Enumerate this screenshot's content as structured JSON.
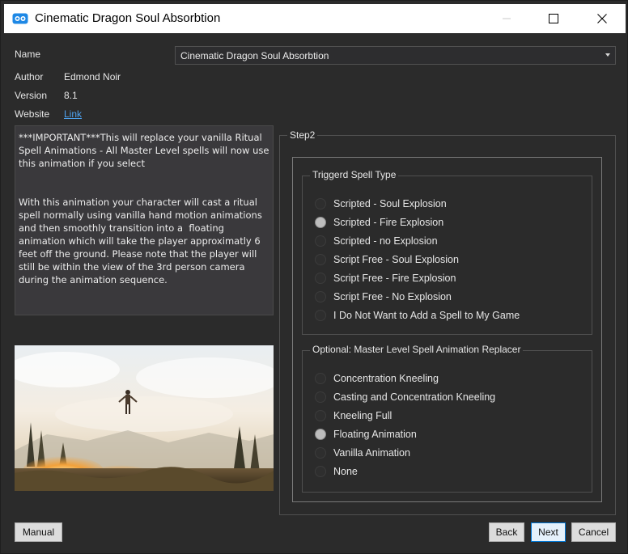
{
  "window": {
    "title": "Cinematic Dragon Soul Absorbtion"
  },
  "info": {
    "name_label": "Name",
    "name_value": "Cinematic Dragon Soul Absorbtion",
    "author_label": "Author",
    "author_value": "Edmond Noir",
    "version_label": "Version",
    "version_value": "8.1",
    "website_label": "Website",
    "website_value": "Link"
  },
  "description": "***IMPORTANT***This will replace your vanilla Ritual Spell Animations - All Master Level spells will now use this animation if you select\n\n\nWith this animation your character will cast a ritual spell normally using vanilla hand motion animations and then smoothly transition into a  floating animation which will take the player approximatly 6 feet off the ground. Please note that the player will still be within the view of the 3rd person camera during the animation sequence.",
  "step": {
    "title": "Step2",
    "groups": [
      {
        "title": "Triggerd Spell Type",
        "options": [
          {
            "label": "Scripted - Soul Explosion",
            "checked": false
          },
          {
            "label": "Scripted - Fire Explosion",
            "checked": true
          },
          {
            "label": "Scripted - no Explosion",
            "checked": false
          },
          {
            "label": "Script Free - Soul Explosion",
            "checked": false
          },
          {
            "label": "Script Free - Fire Explosion",
            "checked": false
          },
          {
            "label": "Script Free - No Explosion",
            "checked": false
          },
          {
            "label": "I Do Not Want to Add a Spell to My Game",
            "checked": false
          }
        ]
      },
      {
        "title": "Optional: Master Level Spell Animation Replacer",
        "options": [
          {
            "label": "Concentration Kneeling",
            "checked": false
          },
          {
            "label": "Casting and Concentration Kneeling",
            "checked": false
          },
          {
            "label": "Kneeling Full",
            "checked": false
          },
          {
            "label": "Floating Animation",
            "checked": true
          },
          {
            "label": "Vanilla Animation",
            "checked": false
          },
          {
            "label": "None",
            "checked": false
          }
        ]
      }
    ]
  },
  "buttons": {
    "manual": "Manual",
    "back": "Back",
    "next": "Next",
    "cancel": "Cancel"
  },
  "colors": {
    "background": "#2b2b2b",
    "link": "#4ea3f0",
    "accent": "#0078d7"
  }
}
